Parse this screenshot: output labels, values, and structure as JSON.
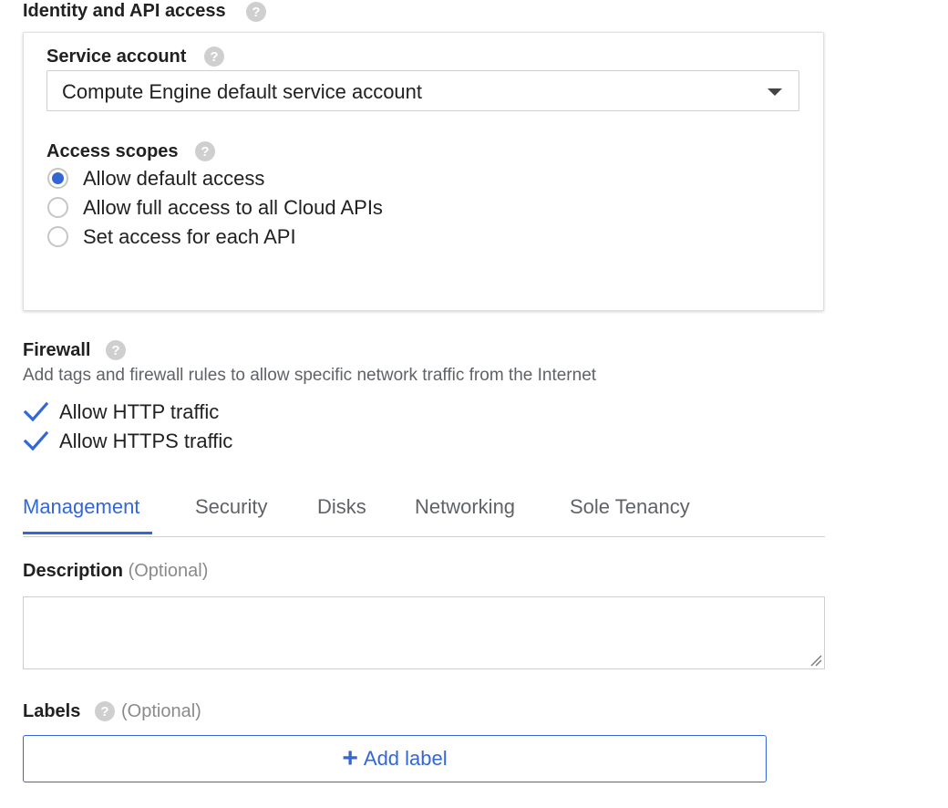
{
  "identity": {
    "title": "Identity and API access",
    "service_account": {
      "label": "Service account",
      "value": "Compute Engine default service account"
    },
    "access_scopes": {
      "label": "Access scopes",
      "options": [
        {
          "label": "Allow default access",
          "checked": true
        },
        {
          "label": "Allow full access to all Cloud APIs",
          "checked": false
        },
        {
          "label": "Set access for each API",
          "checked": false
        }
      ]
    }
  },
  "firewall": {
    "title": "Firewall",
    "description": "Add tags and firewall rules to allow specific network traffic from the Internet",
    "options": [
      {
        "label": "Allow HTTP traffic",
        "checked": true
      },
      {
        "label": "Allow HTTPS traffic",
        "checked": true
      }
    ]
  },
  "tabs": [
    {
      "label": "Management",
      "active": true
    },
    {
      "label": "Security",
      "active": false
    },
    {
      "label": "Disks",
      "active": false
    },
    {
      "label": "Networking",
      "active": false
    },
    {
      "label": "Sole Tenancy",
      "active": false
    }
  ],
  "description": {
    "label": "Description",
    "optional": "(Optional)",
    "value": ""
  },
  "labels": {
    "label": "Labels",
    "optional": "(Optional)",
    "add_button": "Add label"
  },
  "help_icon_glyph": "?",
  "colors": {
    "accent": "#3367d6",
    "help_icon": "#cfcfcf"
  }
}
